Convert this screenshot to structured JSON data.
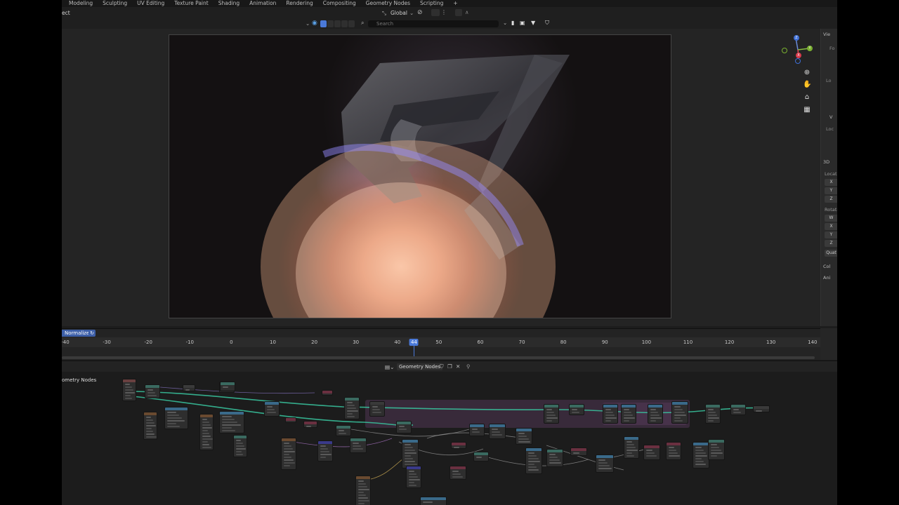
{
  "workspace_tabs": [
    "Modeling",
    "Sculpting",
    "UV Editing",
    "Texture Paint",
    "Shading",
    "Animation",
    "Rendering",
    "Compositing",
    "Geometry Nodes",
    "Scripting",
    "+"
  ],
  "header": {
    "left_fragment": "ect",
    "transform_orientation": "Global"
  },
  "search": {
    "placeholder": "Search"
  },
  "side_panel": {
    "view_tab": "Vie",
    "view_sub1": "Fo",
    "view_sub2": "Lo",
    "view_sub3": "V",
    "view_sub4": "Loc",
    "section_3d": "3D",
    "location_label": "Locati",
    "location_axes": [
      "X",
      "Y",
      "Z"
    ],
    "rotation_label": "Rotatio",
    "rotation_axes": [
      "W",
      "X",
      "Y",
      "Z"
    ],
    "mode_field": "Quat",
    "collapsed_1": "Col",
    "collapsed_2": "Ani"
  },
  "gizmo_axes": {
    "z": "Z",
    "y": "Y",
    "x": "X"
  },
  "timeline": {
    "normalize_label": "Normalize",
    "ticks": [
      "-40",
      "-30",
      "-20",
      "-10",
      "0",
      "10",
      "20",
      "30",
      "40",
      "50",
      "60",
      "70",
      "80",
      "90",
      "100",
      "110",
      "120",
      "130",
      "140"
    ],
    "current_frame": "44"
  },
  "node_editor": {
    "tree_name": "Geometry Nodes",
    "tree_label": "ometry Nodes"
  },
  "colors": {
    "accent": "#4a79d8",
    "link_geometry": "#38c7a0",
    "frame": "#5a3c5f"
  }
}
